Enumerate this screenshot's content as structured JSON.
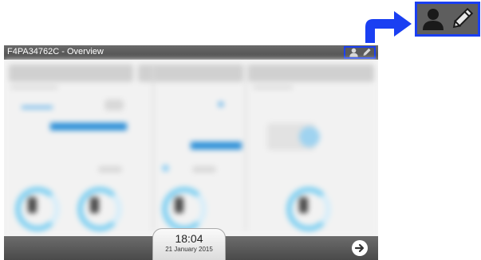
{
  "window": {
    "title": "F4PA34762C - Overview"
  },
  "header": {
    "user_icon": "user-icon",
    "edit_icon": "pencil-icon"
  },
  "footer": {
    "time": "18:04",
    "date": "21 January 2015",
    "next_icon": "arrow-right-circle-icon"
  },
  "callout": {
    "arrow_color": "#1a3ff2",
    "user_icon": "user-icon",
    "edit_icon": "pencil-icon"
  },
  "colors": {
    "accent": "#2a8fd8",
    "highlight_border": "#1a3ff2",
    "bar": "#555555"
  }
}
